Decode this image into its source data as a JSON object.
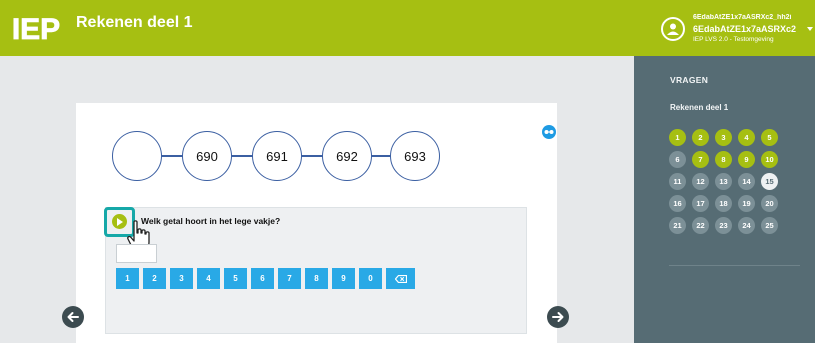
{
  "header": {
    "logo_text": "IEP",
    "title": "Rekenen deel 1",
    "user": {
      "line1": "6EdabAtZE1x7aASRXc2_hh2i",
      "line2": "6EdabAtZE1x7aASRXc2",
      "line3": "IEP LVS 2.0 - Testomgeving"
    },
    "accent_color": "#a6bf12"
  },
  "panel": {
    "heading": "VRAGEN",
    "section_title": "Rekenen deel 1",
    "questions": [
      {
        "label": "1",
        "state": "answered"
      },
      {
        "label": "2",
        "state": "answered"
      },
      {
        "label": "3",
        "state": "answered"
      },
      {
        "label": "4",
        "state": "answered"
      },
      {
        "label": "5",
        "state": "answered"
      },
      {
        "label": "6",
        "state": "open"
      },
      {
        "label": "7",
        "state": "answered"
      },
      {
        "label": "8",
        "state": "answered"
      },
      {
        "label": "9",
        "state": "answered"
      },
      {
        "label": "10",
        "state": "answered"
      },
      {
        "label": "11",
        "state": "open"
      },
      {
        "label": "12",
        "state": "open"
      },
      {
        "label": "13",
        "state": "open"
      },
      {
        "label": "14",
        "state": "open"
      },
      {
        "label": "15",
        "state": "current"
      },
      {
        "label": "16",
        "state": "open"
      },
      {
        "label": "17",
        "state": "open"
      },
      {
        "label": "18",
        "state": "open"
      },
      {
        "label": "19",
        "state": "open"
      },
      {
        "label": "20",
        "state": "open"
      },
      {
        "label": "21",
        "state": "open"
      },
      {
        "label": "22",
        "state": "open"
      },
      {
        "label": "23",
        "state": "open"
      },
      {
        "label": "24",
        "state": "open"
      },
      {
        "label": "25",
        "state": "open"
      }
    ]
  },
  "question": {
    "number_line": [
      "",
      "690",
      "691",
      "692",
      "693"
    ],
    "text": "Welk getal hoort in het lege vakje?",
    "answer_value": "",
    "keypad": [
      "1",
      "2",
      "3",
      "4",
      "5",
      "6",
      "7",
      "8",
      "9",
      "0"
    ],
    "backspace_icon": "backspace-icon"
  },
  "icons": {
    "glasses": "glasses-icon",
    "prev": "arrow-left-icon",
    "next": "arrow-right-icon",
    "audio": "play-icon",
    "cursor": "hand-pointer-icon"
  }
}
